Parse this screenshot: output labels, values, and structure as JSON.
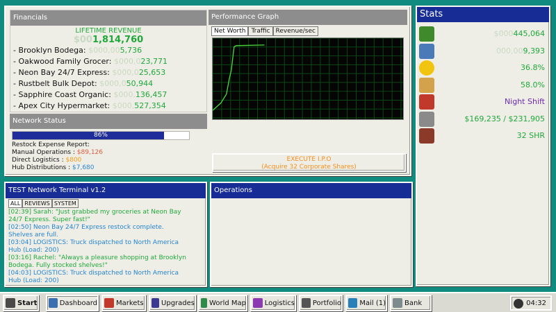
{
  "financials": {
    "title": "Financials",
    "lifetime_label": "LIFETIME REVENUE",
    "lifetime_prefix_dim": "$00",
    "lifetime_value": "1,814,760",
    "businesses": [
      {
        "name": "- Brooklyn Bodega:",
        "dim": "$000,00",
        "value": "5,736"
      },
      {
        "name": "- Oakwood Family Grocer:",
        "dim": "$000,0",
        "value": "23,771"
      },
      {
        "name": "- Neon Bay 24/7 Express:",
        "dim": "$000,0",
        "value": "25,653"
      },
      {
        "name": "- Rustbelt Bulk Depot:",
        "dim": "$000,0",
        "value": "50,944"
      },
      {
        "name": "- Sapphire Coast Organic:",
        "dim": "$000,",
        "value": "136,457"
      },
      {
        "name": "- Apex City Hypermarket:",
        "dim": "$000,",
        "value": "527,354"
      }
    ]
  },
  "network": {
    "title": "Network Status",
    "progress_percent": 86,
    "progress_label": "86%",
    "report_title": "Restock Expense Report:",
    "rows": [
      {
        "label": "Manual Operations :",
        "value": "$89,126",
        "color": "#e45a3e"
      },
      {
        "label": "Direct Logistics   :",
        "value": "$800",
        "color": "#f29c1b"
      },
      {
        "label": "Hub Distributions :",
        "value": "$7,680",
        "color": "#2b86d6"
      }
    ]
  },
  "performance": {
    "title": "Performance Graph",
    "tabs": [
      "Net Worth",
      "Traffic",
      "Revenue/sec"
    ],
    "active_tab": 0,
    "line_color": "#4cd93f",
    "line_points": [
      0.0,
      0.12,
      0.62,
      0.92,
      0.93,
      0.93
    ],
    "ipo_line1": "EXECUTE I.P.O",
    "ipo_line2": "(Acquire 32 Corporate Shares)"
  },
  "stats": {
    "title": "Stats",
    "items": [
      {
        "icon": "money-bills-icon",
        "value": "445,064",
        "dim": "$000",
        "style": "g"
      },
      {
        "icon": "customers-icon",
        "value": "9,393",
        "dim": "000,00",
        "style": "g"
      },
      {
        "icon": "happy-face-icon",
        "value": "36.8%",
        "dim": "",
        "style": "g"
      },
      {
        "icon": "thumbs-up-icon",
        "value": "58.0%",
        "dim": "",
        "style": "g"
      },
      {
        "icon": "alarm-clock-icon",
        "value": "Night Shift",
        "dim": "",
        "style": "p"
      },
      {
        "icon": "vault-icon",
        "value": "$169,235 / $231,905",
        "dim": "",
        "style": "g"
      },
      {
        "icon": "briefcase-icon",
        "value": "32 SHR",
        "dim": "",
        "style": "g"
      }
    ]
  },
  "terminal": {
    "title": "TEST Network Terminal v1.2",
    "tabs": [
      "ALL",
      "REVIEWS",
      "SYSTEM"
    ],
    "lines": [
      {
        "text": "[02:39] Sarah: \"Just grabbed my groceries at Neon Bay",
        "cls": "lg"
      },
      {
        "text": "24/7 Express. Super fast!\"",
        "cls": "lg"
      },
      {
        "text": "[02:50] Neon Bay 24/7 Express restock complete.",
        "cls": "lb"
      },
      {
        "text": "Shelves are full.",
        "cls": "lb"
      },
      {
        "text": "[03:04] LOGISTICS: Truck dispatched to North America",
        "cls": "lb"
      },
      {
        "text": "Hub (Load: 200)",
        "cls": "lb"
      },
      {
        "text": "[03:16] Rachel: \"Always a pleasure shopping at Brooklyn",
        "cls": "lg"
      },
      {
        "text": "Bodega. Fully stocked shelves!\"",
        "cls": "lg"
      },
      {
        "text": "[04:03] LOGISTICS: Truck dispatched to North America",
        "cls": "lb"
      },
      {
        "text": "Hub (Load: 200)",
        "cls": "lb"
      }
    ]
  },
  "operations": {
    "title": "Operations"
  },
  "taskbar": {
    "start": "Start",
    "items": [
      "Dashboard",
      "Markets",
      "Upgrades",
      "World Map",
      "Logistics",
      "Portfolio",
      "Mail (1)",
      "Bank"
    ],
    "active": "Dashboard",
    "clock": "04:32"
  }
}
